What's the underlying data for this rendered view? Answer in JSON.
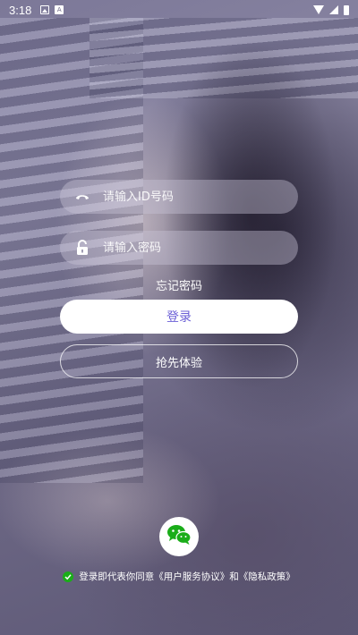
{
  "status_bar": {
    "time": "3:18",
    "icons": [
      "image-icon",
      "a-icon",
      "wifi-icon",
      "signal-icon",
      "battery-icon"
    ]
  },
  "login": {
    "id_placeholder": "请输入ID号码",
    "password_placeholder": "请输入密码",
    "forgot_password": "忘记密码",
    "login_button": "登录",
    "try_button": "抢先体验"
  },
  "social": {
    "wechat_icon": "wechat-icon"
  },
  "agreement": {
    "prefix": "登录即代表你同意",
    "terms": "《用户服务协议》",
    "and": "和",
    "privacy": "《隐私政策》"
  },
  "colors": {
    "accent": "#6b5fd6",
    "wechat": "#1aad19",
    "check": "#1aad19"
  }
}
